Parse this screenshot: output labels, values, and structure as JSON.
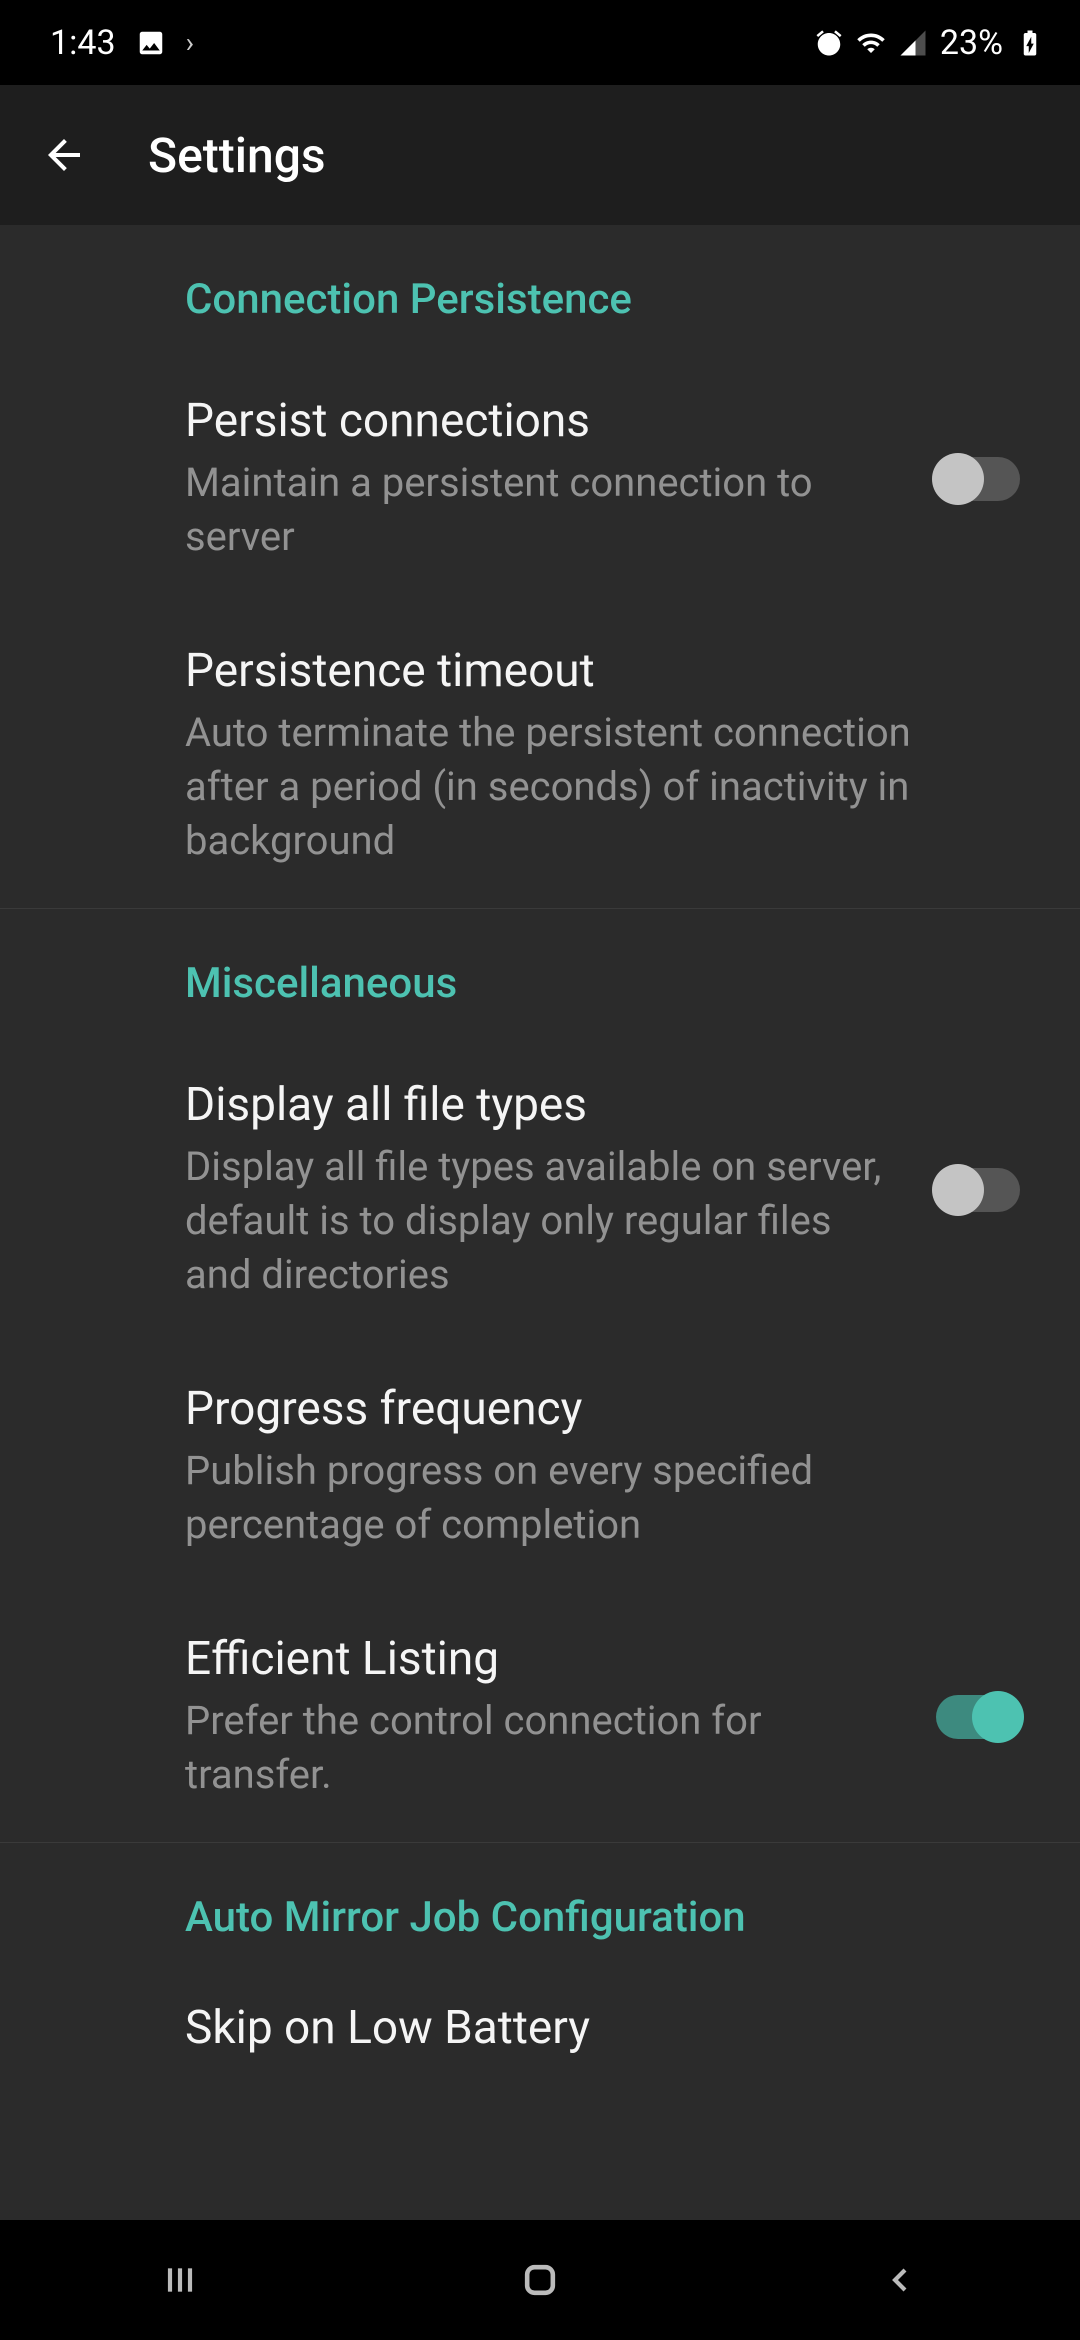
{
  "status_bar": {
    "time": "1:43",
    "battery_text": "23%"
  },
  "app_bar": {
    "title": "Settings"
  },
  "sections": {
    "connection_persistence": {
      "header": "Connection Persistence",
      "persist_connections": {
        "title": "Persist connections",
        "subtitle": "Maintain a persistent connection to server",
        "enabled": false
      },
      "persistence_timeout": {
        "title": "Persistence timeout",
        "subtitle": "Auto terminate the persistent connection after a period (in seconds) of inactivity in background"
      }
    },
    "miscellaneous": {
      "header": "Miscellaneous",
      "display_all_file_types": {
        "title": "Display all file types",
        "subtitle": "Display all file types available on server, default is to display only regular files and directories",
        "enabled": false
      },
      "progress_frequency": {
        "title": "Progress frequency",
        "subtitle": "Publish progress on every specified percentage of completion"
      },
      "efficient_listing": {
        "title": "Efficient Listing",
        "subtitle": "Prefer the control connection for transfer.",
        "enabled": true
      }
    },
    "auto_mirror": {
      "header": "Auto Mirror Job Configuration",
      "skip_on_low_battery": {
        "title": "Skip on Low Battery"
      }
    }
  }
}
